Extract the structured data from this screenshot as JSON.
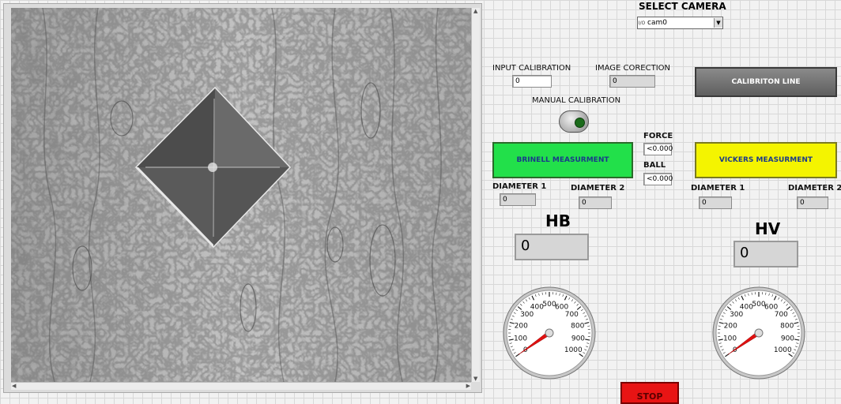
{
  "camera": {
    "label": "SELECT CAMERA",
    "value": "cam0",
    "io_icon": "I/O"
  },
  "calibration": {
    "input_label": "INPUT CALIBRATION",
    "input_value": "0",
    "correction_label": "IMAGE CORECTION",
    "correction_value": "0",
    "manual_label": "MANUAL CALIBRATION",
    "line_button": "CALIBRITON  LINE"
  },
  "brinell": {
    "button": "BRINELL MEASURMENT",
    "d1_label": "DIAMETER 1",
    "d1_value": "0",
    "d2_label": "DIAMETER 2",
    "d2_value": "0",
    "result_label": "HB",
    "result_value": "0"
  },
  "params": {
    "force_label": "FORCE",
    "force_value": "<0.000",
    "ball_label": "BALL",
    "ball_value": "<0.000"
  },
  "vickers": {
    "button": "VICKERS MEASURMENT",
    "d1_label": "DIAMETER 1",
    "d1_value": "0",
    "d2_label": "DIAMETER 2",
    "d2_value": "0",
    "result_label": "HV",
    "result_value": "0"
  },
  "gauge": {
    "ticks": [
      "0",
      "100",
      "200",
      "300",
      "400",
      "500",
      "600",
      "700",
      "800",
      "900",
      "1000"
    ],
    "min": 0,
    "max": 1000,
    "value": 0
  },
  "stop_button": "STOP",
  "colors": {
    "brinell": "#22e04a",
    "vickers": "#f4f400",
    "stop": "#e81414",
    "calib_btn": "#6e6e6e"
  }
}
